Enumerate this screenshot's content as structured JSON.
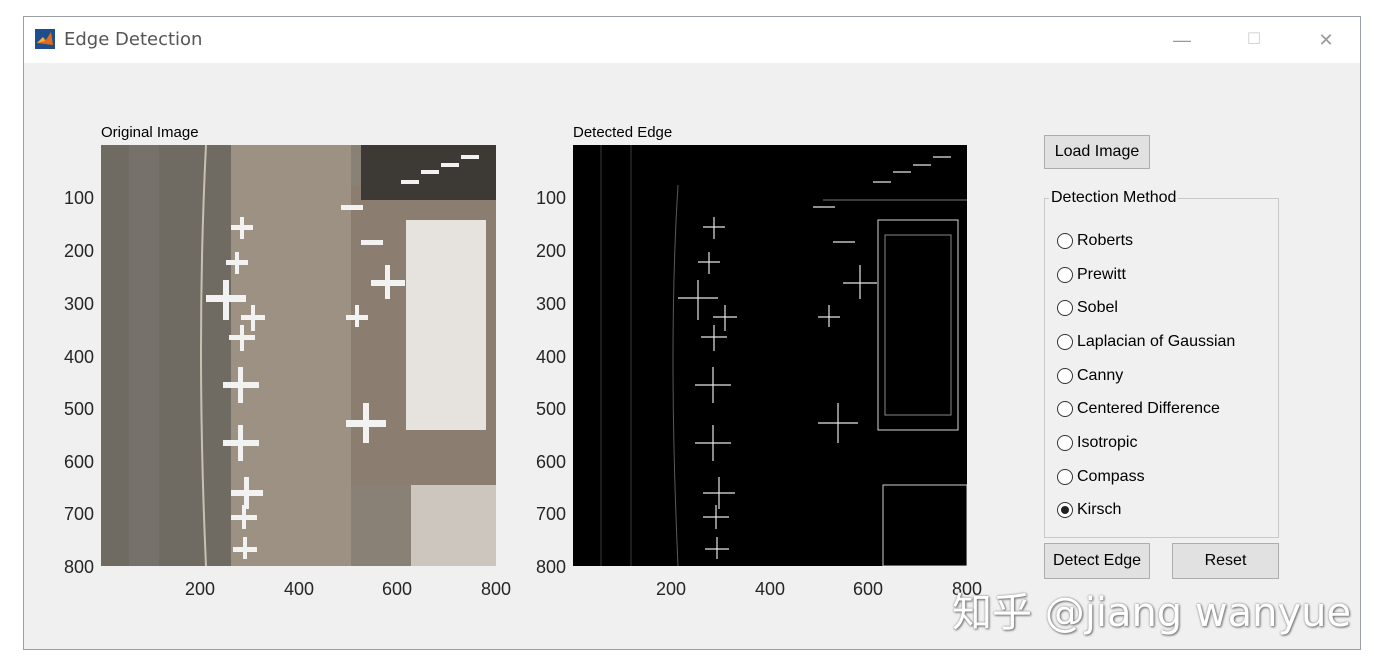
{
  "window": {
    "title": "Edge Detection",
    "minimize": "—",
    "maximize": "☐",
    "close": "✕"
  },
  "axes_left": {
    "title": "Original Image",
    "y_ticks": [
      "100",
      "200",
      "300",
      "400",
      "500",
      "600",
      "700",
      "800"
    ],
    "x_ticks": [
      "200",
      "400",
      "600",
      "800"
    ]
  },
  "axes_right": {
    "title": "Detected Edge",
    "y_ticks": [
      "100",
      "200",
      "300",
      "400",
      "500",
      "600",
      "700",
      "800"
    ],
    "x_ticks": [
      "200",
      "400",
      "600",
      "800"
    ]
  },
  "controls": {
    "load_label": "Load Image",
    "group_title": "Detection Method",
    "methods": [
      {
        "label": "Roberts",
        "selected": false
      },
      {
        "label": "Prewitt",
        "selected": false
      },
      {
        "label": "Sobel",
        "selected": false
      },
      {
        "label": "Laplacian of Gaussian",
        "selected": false
      },
      {
        "label": "Canny",
        "selected": false
      },
      {
        "label": "Centered Difference",
        "selected": false
      },
      {
        "label": "Isotropic",
        "selected": false
      },
      {
        "label": "Compass",
        "selected": false
      },
      {
        "label": "Kirsch",
        "selected": true
      }
    ],
    "detect_label": "Detect Edge",
    "reset_label": "Reset"
  },
  "watermark": "知乎 @jiang wanyue",
  "colors": {
    "accent": "#0072bd",
    "panel": "#f0f0f0",
    "button": "#e1e1e1"
  }
}
